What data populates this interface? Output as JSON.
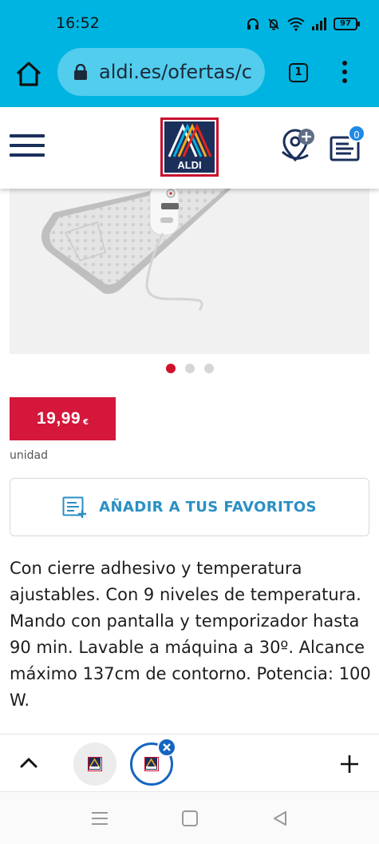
{
  "status_bar": {
    "time": "16:52",
    "battery": "97",
    "icons": [
      "headphones-icon",
      "mute-icon",
      "wifi-icon",
      "signal-icon",
      "battery-icon"
    ]
  },
  "browser": {
    "url": "aldi.es/ofertas/c",
    "tab_count": "1",
    "icons": [
      "home-icon",
      "lock-icon",
      "menu-dots-icon"
    ]
  },
  "site_header": {
    "logo_text": "ALDI",
    "cart_count": "0",
    "colors": {
      "navy": "#1b2f5b",
      "aldi_red": "#c8102e",
      "aldi_blue": "#1e88e5"
    }
  },
  "product": {
    "carousel_dots": 3,
    "carousel_active": 0,
    "price": "19,99",
    "currency": "€",
    "unit": "unidad",
    "favorites_label": "AÑADIR A TUS FAVORITOS",
    "description": "Con cierre adhesivo y temperatura ajustables. Con 9 niveles de temperatura. Mando con pantalla y temporizador hasta 90 min. Lavable a máquina a 30º. Alcance máximo 137cm de contorno. Potencia: 100 W.",
    "colors": {
      "price_bg": "#d4173a",
      "favorites_text": "#2a8fc5",
      "dot_active": "#d0112b"
    }
  },
  "tab_bar": {
    "icons": [
      "chevron-up-icon",
      "tab-thumbnail-icon",
      "close-icon",
      "plus-icon"
    ]
  },
  "nav_bar": {
    "icons": [
      "recent-apps-icon",
      "home-square-icon",
      "back-triangle-icon"
    ]
  }
}
